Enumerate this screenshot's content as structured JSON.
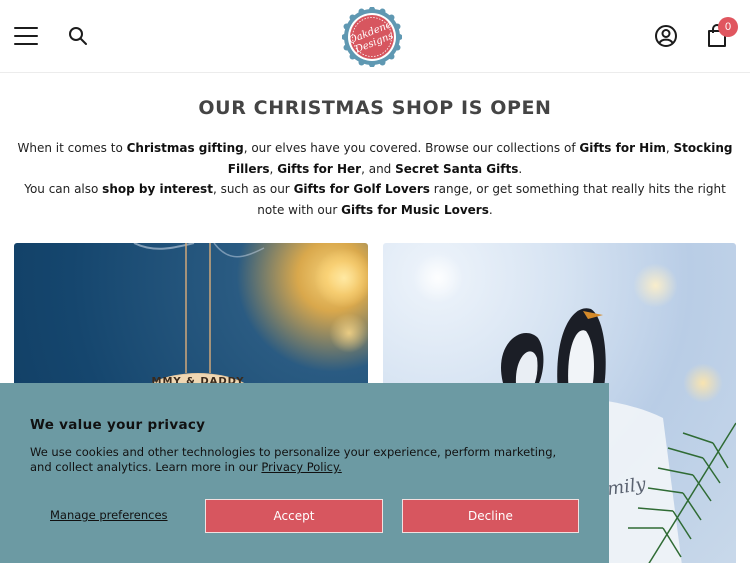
{
  "header": {
    "menu_icon": "hamburger-menu-icon",
    "search_icon": "search-icon",
    "logo_text_top": "Oakdene",
    "logo_text_bottom": "Designs",
    "account_icon": "account-icon",
    "cart_icon": "shopping-bag-icon",
    "cart_count": "0",
    "brand_color": "#d7565f",
    "logo_ring_color": "#5f98b2"
  },
  "main": {
    "heading": "OUR CHRISTMAS SHOP IS OPEN",
    "p1_a": "When it comes to ",
    "p1_b": "Christmas gifting",
    "p1_c": ", our elves have you covered. Browse our collections of ",
    "p1_d": "Gifts for Him",
    "p1_e": ", ",
    "p1_f": "Stocking Fillers",
    "p1_g": ", ",
    "p1_h": "Gifts for Her",
    "p1_i": ", and ",
    "p1_j": "Secret Santa Gifts",
    "p1_k": ".",
    "p2_a": "You can also ",
    "p2_b": "shop by interest",
    "p2_c": ", such as our ",
    "p2_d": "Gifts for Golf Lovers",
    "p2_e": " range, or get something that really hits the right note with our ",
    "p2_f": "Gifts for Music Lovers",
    "p2_g": ".",
    "card_left_ornament_text": "MMY & DADDY",
    "card_right_ornament_text": "mily"
  },
  "cookie_banner": {
    "title": "We value your privacy",
    "text": "We use cookies and other technologies to personalize your experience, perform marketing, and collect analytics. Learn more in our ",
    "link": "Privacy Policy.",
    "manage": "Manage preferences",
    "accept": "Accept",
    "decline": "Decline",
    "background": "#6c9aa3"
  }
}
